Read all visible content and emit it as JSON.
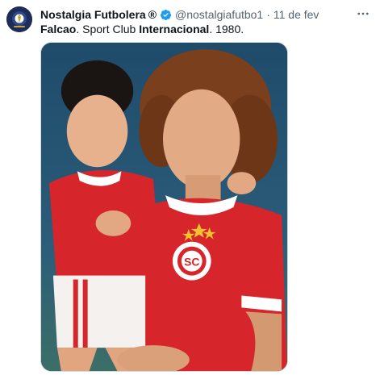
{
  "tweet": {
    "display_name": "Nostalgia Futbolera",
    "registered_mark": "®",
    "handle": "@nostalgiafutbo1",
    "separator": "·",
    "date": "11 de fev",
    "text": {
      "part1_bold": "Falcao",
      "part2": ". Sport Club ",
      "part3_bold": "Internacional",
      "part4": ". 1980."
    }
  },
  "icons": {
    "avatar": "team-logo-avatar",
    "verified": "verified-badge-icon",
    "more": "more-options-icon"
  },
  "colors": {
    "verified_blue": "#1d9bf0",
    "secondary_text": "#536471",
    "jersey_red": "#d7262b"
  },
  "media": {
    "description_icon": "photo"
  }
}
